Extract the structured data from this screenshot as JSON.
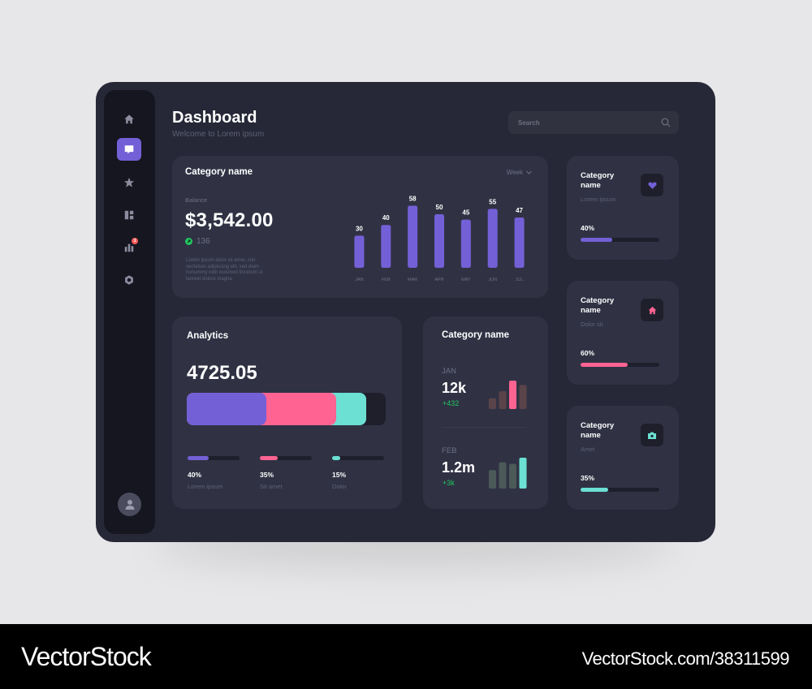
{
  "header": {
    "title": "Dashboard",
    "subtitle": "Welcome to Lorem ipsum"
  },
  "search": {
    "placeholder": "Search",
    "value": ""
  },
  "sidebar": {
    "items": [
      {
        "name": "home",
        "icon": "home-icon",
        "active": false
      },
      {
        "name": "messages",
        "icon": "chat-icon",
        "active": true
      },
      {
        "name": "favorites",
        "icon": "star-icon",
        "active": false
      },
      {
        "name": "dashboard",
        "icon": "dashboard-icon",
        "active": false
      },
      {
        "name": "analytics",
        "icon": "bar-chart-icon",
        "active": false,
        "badge": "3"
      },
      {
        "name": "settings",
        "icon": "settings-icon",
        "active": false
      }
    ],
    "avatar": "user-avatar"
  },
  "balance_card": {
    "title": "Category name",
    "period_select": "Week",
    "balance_label": "Balance",
    "balance_amount": "$3,542.00",
    "delta": "136",
    "description": "Lorem ipsum dolor sit amet, con-sectetuer adipiscing elit, sed diam nonummy nibh euismod tincidunt ut laoreet dolore magna",
    "accent": "#7460d6"
  },
  "chart_data": {
    "type": "bar",
    "title": "Category name",
    "categories": [
      "JAN",
      "FEB",
      "MAR",
      "APR",
      "MAY",
      "JUN",
      "JUL"
    ],
    "values": [
      30,
      40,
      58,
      50,
      45,
      55,
      47
    ],
    "xlabel": "",
    "ylabel": "",
    "ylim": [
      0,
      60
    ],
    "grid": false,
    "color": "#7460d6"
  },
  "analytics": {
    "title": "Analytics",
    "value": "4725.05",
    "segments": [
      {
        "label": "Lorem ipsum",
        "percent": 40,
        "percent_label": "40%",
        "color": "#7460d6"
      },
      {
        "label": "Sit amet",
        "percent": 35,
        "percent_label": "35%",
        "color": "#ff6392"
      },
      {
        "label": "Dolor",
        "percent": 15,
        "percent_label": "15%",
        "color": "#6be0d3"
      }
    ]
  },
  "monthly": {
    "title": "Category name",
    "entries": [
      {
        "month": "JAN",
        "value": "12k",
        "delta": "+432",
        "bars": [
          0.35,
          0.58,
          0.92,
          0.78
        ],
        "highlight_index": 2,
        "highlight_color": "#ff6392",
        "muted_color": "#5a4449"
      },
      {
        "month": "FEB",
        "value": "1.2m",
        "delta": "+3k",
        "bars": [
          0.6,
          0.85,
          0.8,
          1.0
        ],
        "highlight_index": 3,
        "highlight_color": "#6be0d3",
        "muted_color": "#4b5a58"
      }
    ]
  },
  "side_cards": [
    {
      "title": "Category name",
      "subtitle": "Lorem ipsum",
      "percent": 40,
      "percent_label": "40%",
      "icon": "heart-icon",
      "color": "#7460d6"
    },
    {
      "title": "Category name",
      "subtitle": "Dolor sit",
      "percent": 60,
      "percent_label": "60%",
      "icon": "home-icon",
      "color": "#ff6392"
    },
    {
      "title": "Category name",
      "subtitle": "Amet",
      "percent": 35,
      "percent_label": "35%",
      "icon": "camera-icon",
      "color": "#6be0d3"
    }
  ],
  "footer": {
    "brand": "VectorStock",
    "url": "VectorStock.com/38311599"
  }
}
